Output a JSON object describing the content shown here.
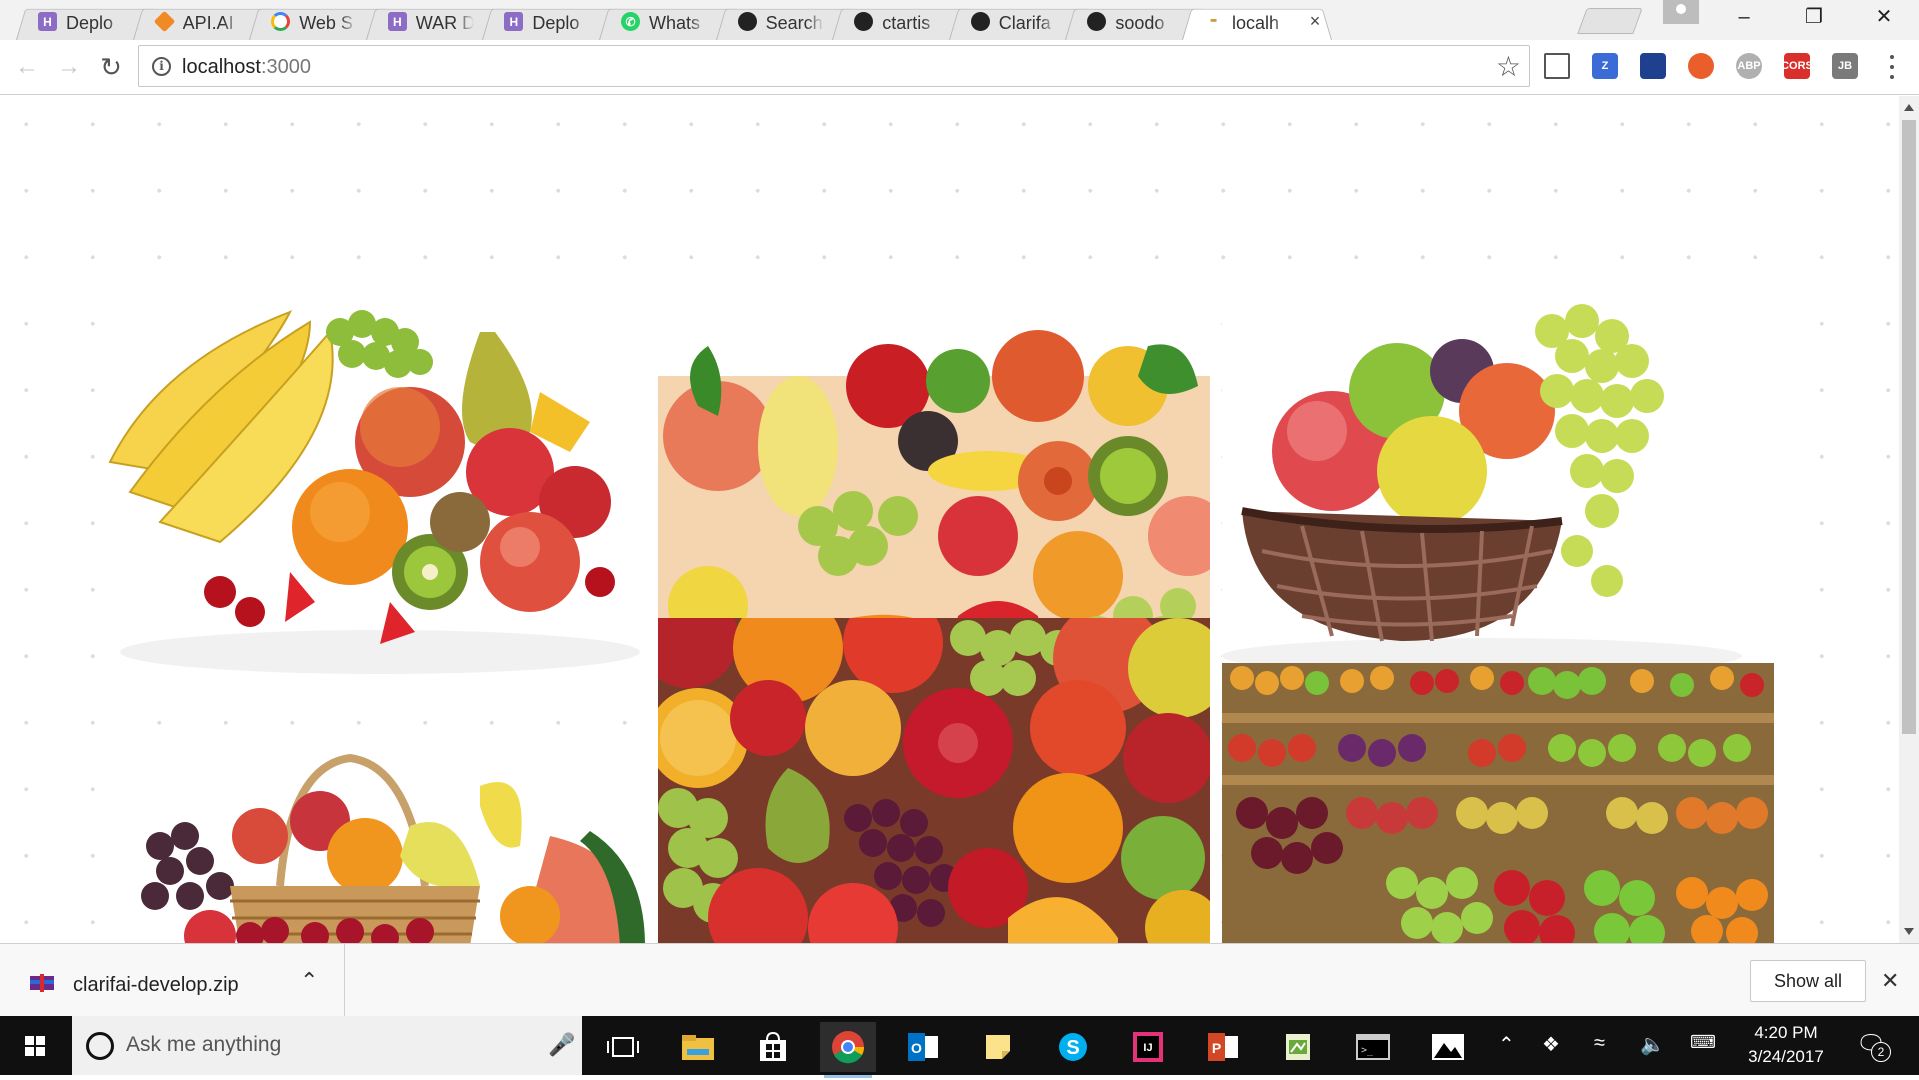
{
  "tabs": [
    {
      "title": "Deplo",
      "favicon": "heroku-icon",
      "color": "#8c6cc4",
      "glyph": "H"
    },
    {
      "title": "API.AI",
      "favicon": "apiai-icon",
      "color": "#f08a24",
      "glyph": ""
    },
    {
      "title": "Web S",
      "favicon": "google-icon",
      "color": "#ffffff",
      "glyph": ""
    },
    {
      "title": "WAR D",
      "favicon": "heroku-icon",
      "color": "#8c6cc4",
      "glyph": "H"
    },
    {
      "title": "Deplo",
      "favicon": "heroku-icon",
      "color": "#8c6cc4",
      "glyph": "H"
    },
    {
      "title": "Whats",
      "favicon": "whatsapp-icon",
      "color": "#25d366",
      "glyph": ""
    },
    {
      "title": "Search",
      "favicon": "github-icon",
      "color": "#222222",
      "glyph": ""
    },
    {
      "title": "ctartis",
      "favicon": "github-icon",
      "color": "#222222",
      "glyph": ""
    },
    {
      "title": "Clarifa",
      "favicon": "github-icon",
      "color": "#222222",
      "glyph": ""
    },
    {
      "title": "soodo",
      "favicon": "github-icon",
      "color": "#222222",
      "glyph": ""
    },
    {
      "title": "localh",
      "favicon": "kangaroo-icon",
      "color": "#ffffff",
      "glyph": "",
      "active": true
    }
  ],
  "address": {
    "host": "localhost",
    "port": ":3000"
  },
  "extensions": [
    {
      "name": "cast-icon",
      "label": "",
      "color": "#ffffff"
    },
    {
      "name": "zotero-icon",
      "label": "Z",
      "color": "#3b6bd6"
    },
    {
      "name": "flag-extension-icon",
      "label": "",
      "color": "#1f3f8f"
    },
    {
      "name": "colorful-extension-icon",
      "label": "",
      "color": "#e95e2b"
    },
    {
      "name": "adblock-plus-icon",
      "label": "ABP",
      "color": "#b0b0b0"
    },
    {
      "name": "cors-icon",
      "label": "CORS",
      "color": "#d9302c"
    },
    {
      "name": "jetbrains-icon",
      "label": "JB",
      "color": "#7a7a7a"
    }
  ],
  "download": {
    "filename": "clarifai-develop.zip",
    "show_all": "Show all"
  },
  "taskbar": {
    "search_placeholder": "Ask me anything",
    "time": "4:20 PM",
    "date": "3/24/2017",
    "notifications": "2"
  },
  "gallery": [
    "fruit-pile-bananas-photo",
    "fruits-vegetables-row-photo",
    "fruit-basket-grapes-photo",
    "wicker-fruit-basket-photo",
    "mixed-fruit-closeup-photo",
    "market-fruit-stalls-photo"
  ]
}
